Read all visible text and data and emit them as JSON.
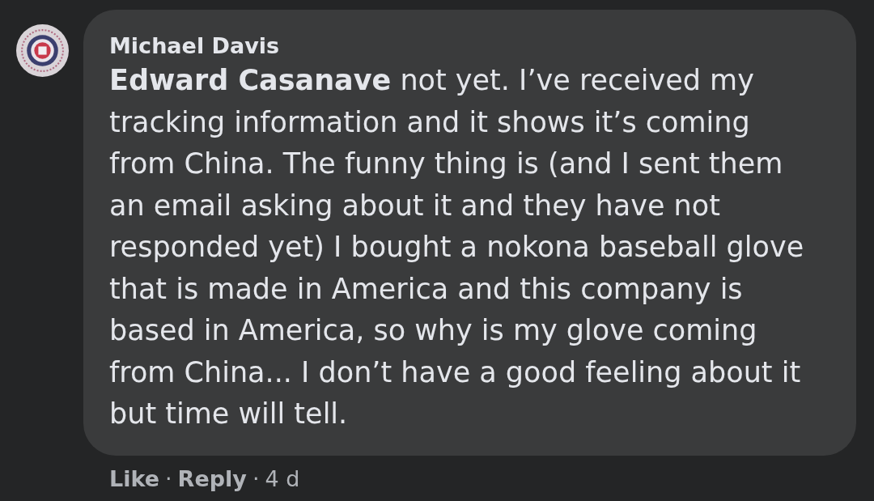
{
  "comment": {
    "author": "Michael Davis",
    "text": "**Edward Casanave** not yet. I’ve received my tracking information and it shows it’s coming from China. The funny thing is (and I sent them an email asking about it and they have not responded yet) I bought a nokona baseball glove that is made in America and this company is based in America, so why is my glove coming from China... I don’t have a good feeling about it but time will tell.",
    "footer": [
      {
        "kind": "link",
        "text": "Like"
      },
      {
        "kind": "separator",
        "text": "·"
      },
      {
        "kind": "link",
        "text": "Reply"
      },
      {
        "kind": "separator",
        "text": "·"
      },
      {
        "kind": "time",
        "text": "4 d"
      }
    ]
  }
}
